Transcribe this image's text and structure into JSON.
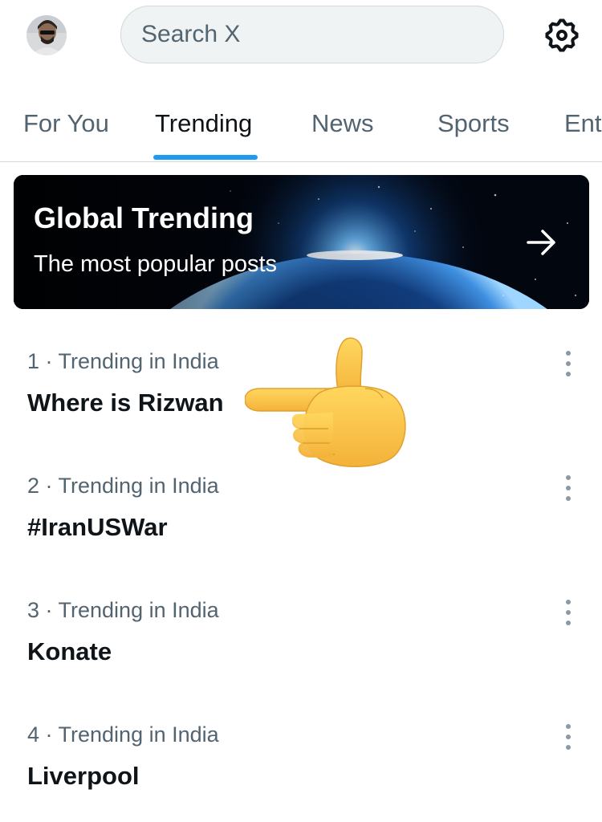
{
  "header": {
    "search_placeholder": "Search X",
    "avatar_icon": "profile-avatar",
    "settings_icon": "gear-icon"
  },
  "tabs": [
    {
      "label": "For You",
      "active": false
    },
    {
      "label": "Trending",
      "active": true
    },
    {
      "label": "News",
      "active": false
    },
    {
      "label": "Sports",
      "active": false
    },
    {
      "label": "Ent",
      "active": false
    }
  ],
  "banner": {
    "title": "Global Trending",
    "subtitle": "The most popular posts",
    "arrow_icon": "arrow-right-icon"
  },
  "trends": [
    {
      "meta": "1 · Trending in India",
      "title": "Where is Rizwan"
    },
    {
      "meta": "2 · Trending in India",
      "title": "#IranUSWar"
    },
    {
      "meta": "3 · Trending in India",
      "title": "Konate"
    },
    {
      "meta": "4 · Trending in India",
      "title": "Liverpool"
    }
  ],
  "overlay": {
    "emoji_icon": "pointing-left-hand-icon"
  },
  "colors": {
    "accent": "#1d9bf0",
    "text_primary": "#0f1419",
    "text_secondary": "#536471"
  }
}
